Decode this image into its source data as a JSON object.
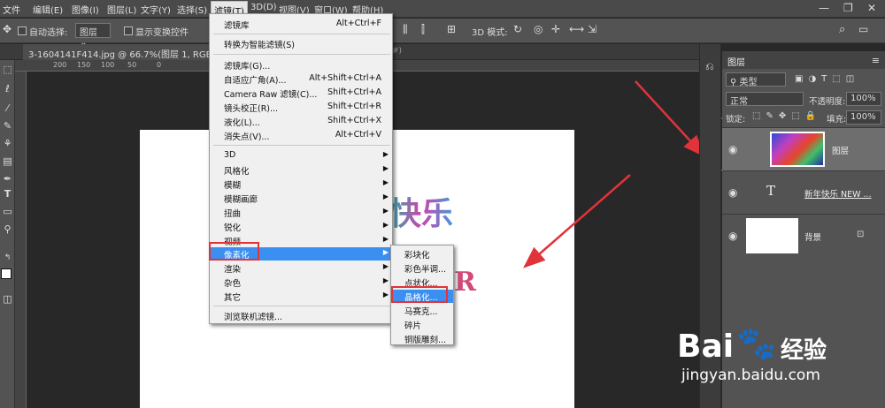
{
  "menubar": {
    "items": [
      "文件",
      "编辑(E)",
      "图像(I)",
      "图层(L)",
      "文字(Y)",
      "选择(S)",
      "滤镜(T)",
      "3D(D)",
      "视图(V)",
      "窗口(W)",
      "帮助(H)"
    ],
    "minimize": "—",
    "maximize": "❐",
    "close": "✕"
  },
  "options": {
    "auto_select_label": "自动选择:",
    "auto_select_value": "图层",
    "show_transform_label": "显示变换控件",
    "mode_3d": "3D 模式:"
  },
  "document": {
    "tab_title": "3-1604141F414.jpg @ 66.7%(图层 1, RGB/8#) *",
    "tab2": "#)",
    "ruler_ticks": [
      "200",
      "150",
      "100",
      "50",
      "0"
    ],
    "text_top": "快乐",
    "text_mid": "R"
  },
  "filter_menu": {
    "items": [
      {
        "label": "滤镜库",
        "shortcut": "Alt+Ctrl+F"
      },
      {
        "label": "转换为智能滤镜(S)",
        "shortcut": ""
      },
      {
        "label": "滤镜库(G)...",
        "shortcut": ""
      },
      {
        "label": "自适应广角(A)...",
        "shortcut": "Alt+Shift+Ctrl+A"
      },
      {
        "label": "Camera Raw 滤镜(C)...",
        "shortcut": "Shift+Ctrl+A"
      },
      {
        "label": "镜头校正(R)...",
        "shortcut": "Shift+Ctrl+R"
      },
      {
        "label": "液化(L)...",
        "shortcut": "Shift+Ctrl+X"
      },
      {
        "label": "消失点(V)...",
        "shortcut": "Alt+Ctrl+V"
      },
      {
        "label": "3D",
        "submenu": true
      },
      {
        "label": "风格化",
        "submenu": true
      },
      {
        "label": "模糊",
        "submenu": true
      },
      {
        "label": "模糊画廊",
        "submenu": true
      },
      {
        "label": "扭曲",
        "submenu": true
      },
      {
        "label": "锐化",
        "submenu": true
      },
      {
        "label": "视频",
        "submenu": true
      },
      {
        "label": "像素化",
        "submenu": true,
        "highlighted": true
      },
      {
        "label": "渲染",
        "submenu": true
      },
      {
        "label": "杂色",
        "submenu": true
      },
      {
        "label": "其它",
        "submenu": true
      },
      {
        "label": "浏览联机滤镜...",
        "shortcut": ""
      }
    ]
  },
  "pixelate_submenu": {
    "items": [
      "彩块化",
      "彩色半调...",
      "点状化...",
      "晶格化...",
      "马赛克...",
      "碎片",
      "铜版雕刻..."
    ],
    "highlighted_index": 3
  },
  "layers_panel": {
    "title": "图层",
    "filter_label": "类型",
    "blend_mode": "正常",
    "opacity_label": "不透明度:",
    "opacity_value": "100%",
    "lock_label": "锁定:",
    "fill_label": "填充:",
    "fill_value": "100%",
    "layers": [
      {
        "name": "图层",
        "type": "image"
      },
      {
        "name": "新年快乐 NEW ...",
        "type": "text"
      },
      {
        "name": "背景",
        "type": "background"
      }
    ]
  },
  "watermark": {
    "brand": "Bai",
    "brand2": "经验",
    "url": "jingyan.baidu.com"
  },
  "colors": {
    "highlight": "#3b8ff0",
    "annotation": "#e0333a"
  }
}
